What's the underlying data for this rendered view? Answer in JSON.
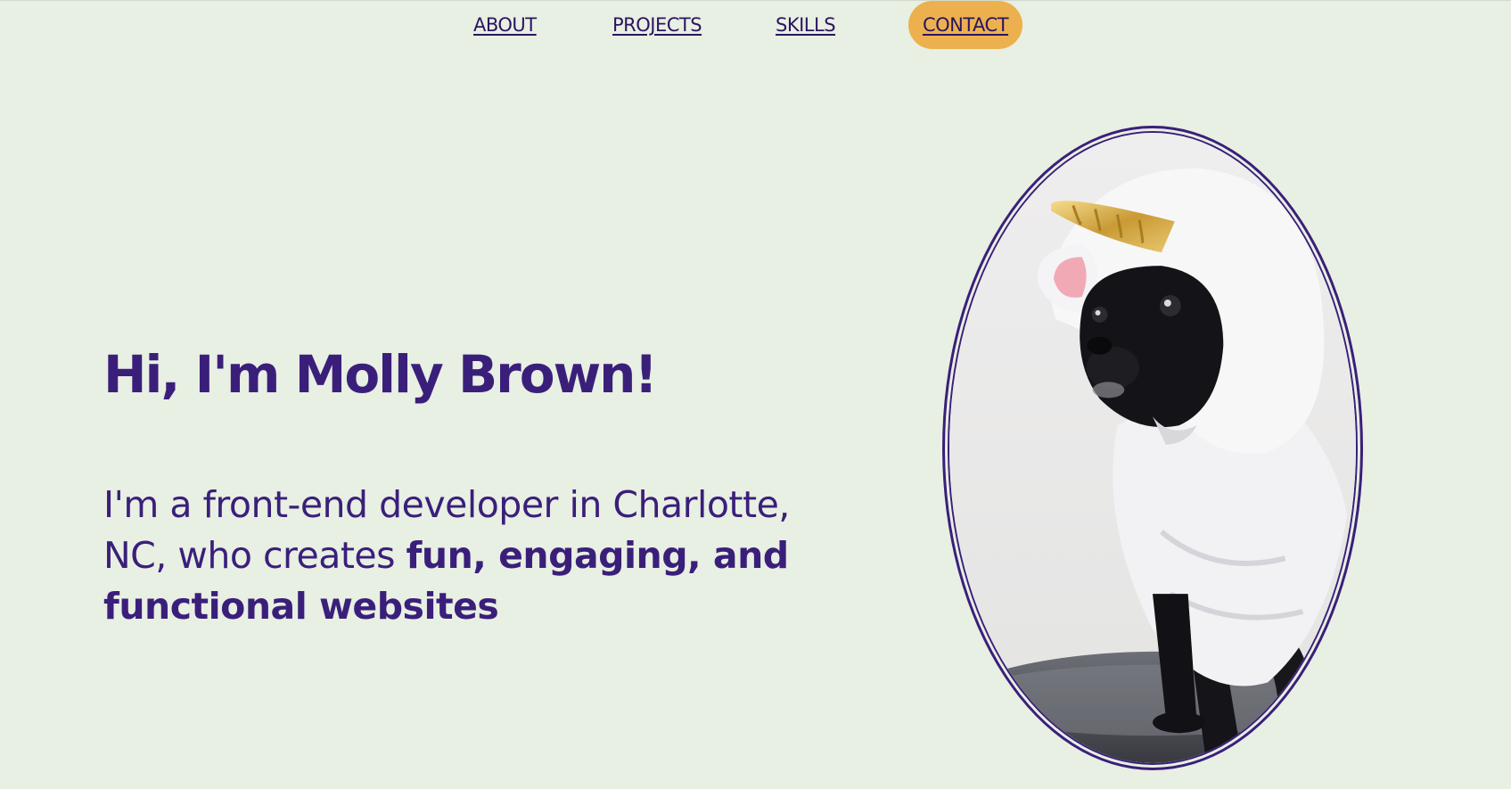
{
  "colors": {
    "background": "#e8efe3",
    "brand_purple": "#3a1f7a",
    "contact_highlight": "#ecb14e"
  },
  "nav": {
    "items": [
      {
        "label": "ABOUT"
      },
      {
        "label": "PROJECTS"
      },
      {
        "label": "SKILLS"
      },
      {
        "label": "CONTACT",
        "active": true
      }
    ]
  },
  "hero": {
    "headline": "Hi, I'm Molly Brown!",
    "intro_prefix": "I'm a front-end developer in Charlotte, NC, who creates ",
    "intro_emphasis": "fun, engaging, and functional websites"
  },
  "photo": {
    "subject": "french-bulldog-in-unicorn-costume"
  }
}
